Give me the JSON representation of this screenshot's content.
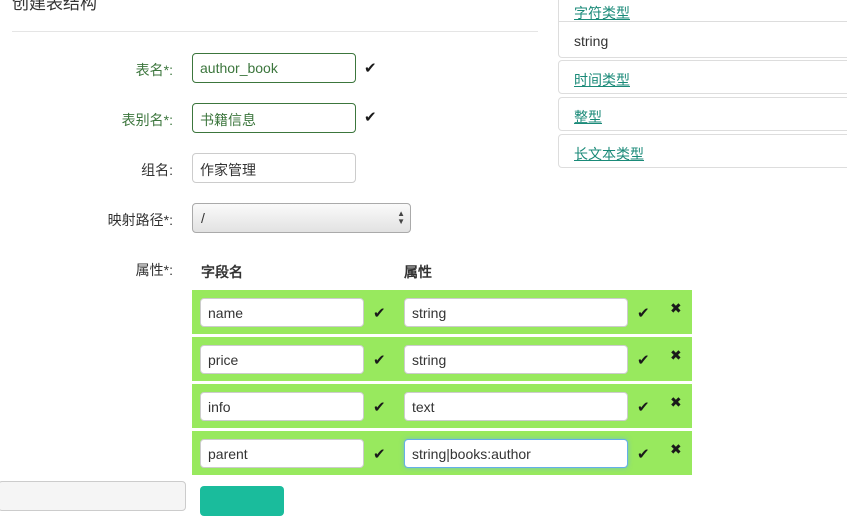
{
  "page": {
    "title": "创建表结构"
  },
  "form": {
    "table_name": {
      "label": "表名*:",
      "value": "author_book"
    },
    "alias": {
      "label": "表别名*:",
      "value": "书籍信息"
    },
    "group": {
      "label": "组名:",
      "value": "作家管理"
    },
    "route": {
      "label": "映射路径*:",
      "value": "/"
    },
    "attributes": {
      "label": "属性*:",
      "col_field": "字段名",
      "col_attr": "属性",
      "rows": [
        {
          "field": "name",
          "attr": "string"
        },
        {
          "field": "price",
          "attr": "string"
        },
        {
          "field": "info",
          "attr": "text"
        },
        {
          "field": "parent",
          "attr": "string|books:author"
        }
      ]
    }
  },
  "sidebar": {
    "items": [
      {
        "label": "字符类型",
        "link": true
      },
      {
        "label": "string",
        "link": false
      },
      {
        "label": "时间类型",
        "link": true
      },
      {
        "label": "整型",
        "link": true
      },
      {
        "label": "长文本类型",
        "link": true
      }
    ]
  },
  "icons": {
    "check": "check-icon",
    "remove": "remove-icon"
  },
  "colors": {
    "valid": "#3c763d",
    "row_bg": "#98e95e",
    "link": "#1a8a78",
    "button": "#1abc9c"
  }
}
